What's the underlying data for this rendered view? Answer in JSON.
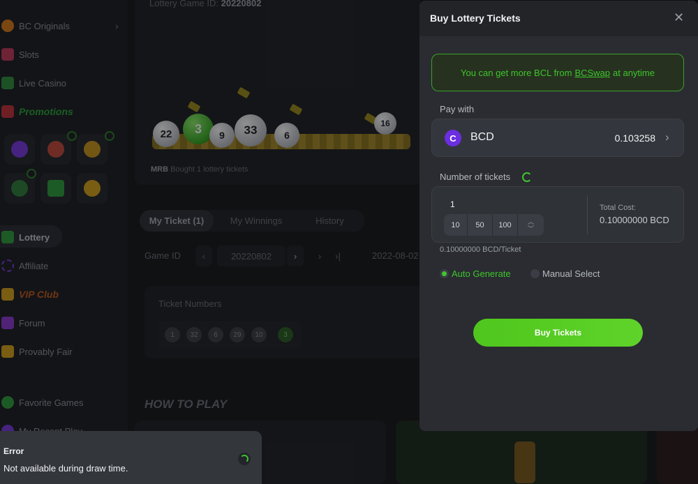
{
  "sidebar": {
    "items": [
      {
        "label": "BC Originals",
        "color": "#d77a1a"
      },
      {
        "label": "Slots",
        "color": "#c23a5c"
      },
      {
        "label": "Live Casino",
        "color": "#2f8e3f"
      },
      {
        "label": "Promotions",
        "color": "#c2323a"
      },
      {
        "label": "Lottery",
        "color": "#2f9f3c"
      },
      {
        "label": "Affiliate",
        "color": "#7a3ae0"
      },
      {
        "label": "VIP Club",
        "color": "#d6a21a"
      },
      {
        "label": "Forum",
        "color": "#8a3ad0"
      },
      {
        "label": "Provably Fair",
        "color": "#d6a21a"
      },
      {
        "label": "Favorite Games",
        "color": "#2f9f3c"
      },
      {
        "label": "My Recent Play",
        "color": "#7a3ae0"
      }
    ]
  },
  "hero": {
    "game_id_label": "Lottery Game ID:",
    "game_id_value": "20220802",
    "balls": [
      "22",
      "3",
      "9",
      "33",
      "6",
      "16"
    ],
    "bought_user": "MRB",
    "bought_text": "Bought 1 lottery tickets"
  },
  "tabs": [
    "My Ticket (1)",
    "My Winnings",
    "History"
  ],
  "game_nav": {
    "label": "Game ID",
    "value": "20220802",
    "date": "2022-08-02"
  },
  "ticket_panel": {
    "label": "Ticket Numbers",
    "numbers": [
      "1",
      "32",
      "6",
      "29",
      "10",
      "3"
    ]
  },
  "how_to_play": "HOW TO PLAY",
  "modal": {
    "title": "Buy Lottery Tickets",
    "banner_prefix": "You can get more BCL from",
    "banner_link": "BCSwap",
    "banner_suffix": "at anytime",
    "pay_with_label": "Pay with",
    "currency": "BCD",
    "balance": "0.103258",
    "tickets_label": "Number of tickets",
    "ticket_count": "1",
    "quick_amounts": [
      "10",
      "50",
      "100"
    ],
    "total_cost_label": "Total Cost:",
    "total_cost_value": "0.10000000 BCD",
    "price_per_ticket": "0.10000000 BCD/Ticket",
    "auto_generate": "Auto Generate",
    "manual_select": "Manual Select",
    "buy_button": "Buy Tickets",
    "accent": "#3fc52e"
  },
  "toast": {
    "title": "Error",
    "message": "Not available during draw time."
  }
}
